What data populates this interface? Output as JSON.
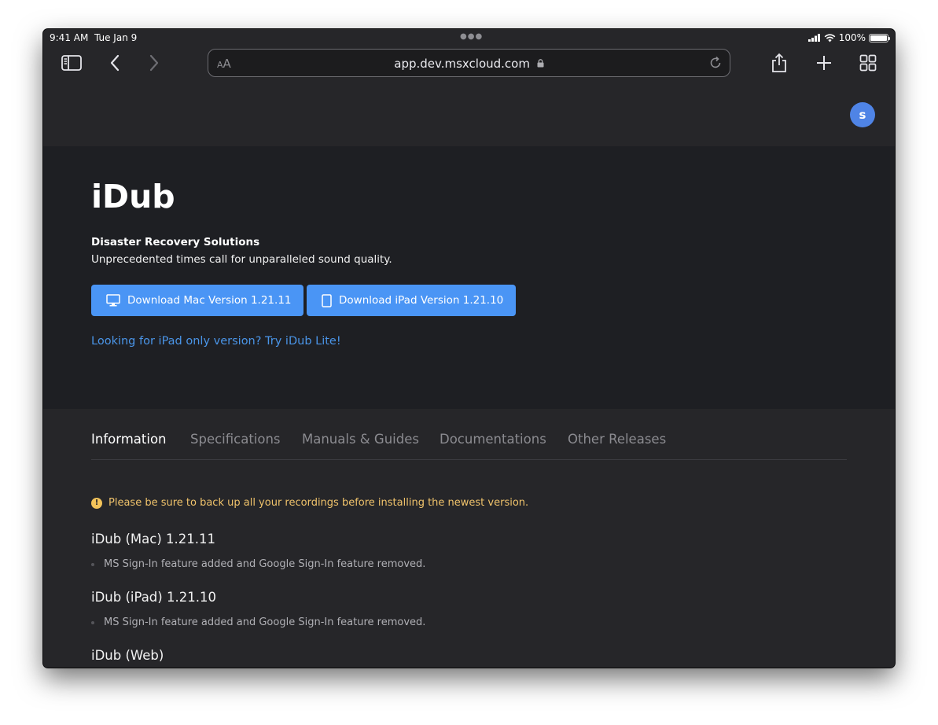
{
  "status_bar": {
    "time": "9:41 AM",
    "date": "Tue Jan 9",
    "battery": "100%"
  },
  "browser": {
    "text_size_button": "AA",
    "url": "app.dev.msxcloud.com",
    "icons": [
      "sidebar-icon",
      "back-icon",
      "forward-icon",
      "lock-icon",
      "reload-icon",
      "share-icon",
      "plus-icon",
      "tabs-icon"
    ]
  },
  "user": {
    "avatar_initial": "s"
  },
  "product": {
    "name": "iDub",
    "subtitle": "Disaster Recovery Solutions",
    "tagline": "Unprecedented times call for unparalleled sound quality.",
    "download_mac_label": "Download Mac Version 1.21.11",
    "download_ipad_label": "Download iPad Version 1.21.10",
    "lite_link": "Looking for iPad only version? Try iDub Lite!"
  },
  "tabs": [
    {
      "label": "Information",
      "active": true
    },
    {
      "label": "Specifications",
      "active": false
    },
    {
      "label": "Manuals & Guides",
      "active": false
    },
    {
      "label": "Documentations",
      "active": false
    },
    {
      "label": "Other Releases",
      "active": false
    }
  ],
  "warning": {
    "icon_text": "!",
    "text": "Please be sure to back up all your recordings before installing the newest version."
  },
  "releases": [
    {
      "title": "iDub (Mac) 1.21.11",
      "items": [
        "MS Sign-In feature added and Google Sign-In feature removed."
      ]
    },
    {
      "title": "iDub (iPad) 1.21.10",
      "items": [
        "MS Sign-In feature added and Google Sign-In feature removed."
      ]
    },
    {
      "title": "iDub (Web)",
      "items": []
    }
  ],
  "colors": {
    "accent": "#4a95f5",
    "link": "#4a95e8",
    "warning": "#f0c36b",
    "avatar": "#4f84e6"
  }
}
